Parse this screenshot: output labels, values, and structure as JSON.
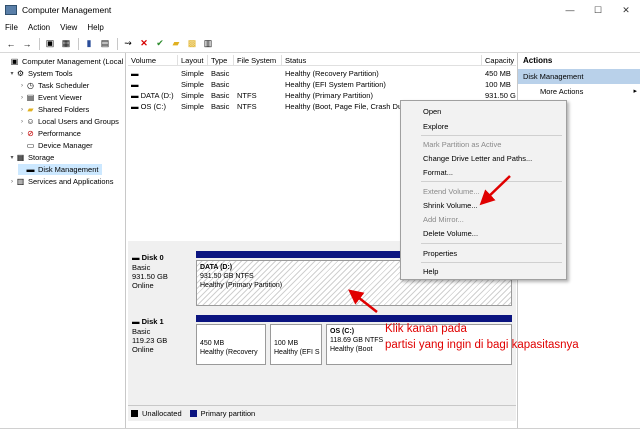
{
  "window": {
    "title": "Computer Management",
    "minimize": "—",
    "maximize": "☐",
    "close": "✕"
  },
  "menu": [
    "File",
    "Action",
    "View",
    "Help"
  ],
  "toolbar": [
    {
      "icon": "back-arrow-icon",
      "glyph": "←"
    },
    {
      "icon": "forward-arrow-icon",
      "glyph": "→"
    },
    {
      "icon": "up-folder-icon",
      "glyph": "▣"
    },
    {
      "icon": "show-hide-tree-icon",
      "glyph": "▦"
    },
    {
      "icon": "help-icon",
      "glyph": "▮"
    },
    {
      "icon": "properties-icon",
      "glyph": "▤"
    },
    {
      "icon": "connect-icon",
      "glyph": "⇝"
    },
    {
      "icon": "delete-icon",
      "glyph": "✕",
      "color": "#d60000"
    },
    {
      "icon": "checkmark-icon",
      "glyph": "✔",
      "color": "#2a8a2a"
    },
    {
      "icon": "folder-icon",
      "glyph": "▰",
      "color": "#e0b020"
    },
    {
      "icon": "search-folder-icon",
      "glyph": "▩",
      "color": "#e0b020"
    },
    {
      "icon": "export-icon",
      "glyph": "▥"
    }
  ],
  "tree": [
    {
      "label": "Computer Management (Local",
      "expander": "",
      "icon": "▣"
    },
    {
      "label": "System Tools",
      "expander": "▾",
      "icon": "⚙"
    },
    {
      "label": "Task Scheduler",
      "expander": "›",
      "icon": "◷"
    },
    {
      "label": "Event Viewer",
      "expander": "›",
      "icon": "▤"
    },
    {
      "label": "Shared Folders",
      "expander": "›",
      "icon": "▰"
    },
    {
      "label": "Local Users and Groups",
      "expander": "›",
      "icon": "☺"
    },
    {
      "label": "Performance",
      "expander": "›",
      "icon": "⊘"
    },
    {
      "label": "Device Manager",
      "expander": "",
      "icon": "▭"
    },
    {
      "label": "Storage",
      "expander": "▾",
      "icon": "▦"
    },
    {
      "label": "Disk Management",
      "expander": "",
      "icon": "▬"
    },
    {
      "label": "Services and Applications",
      "expander": "›",
      "icon": "▥"
    }
  ],
  "volume_table": {
    "headers": [
      "Volume",
      "Layout",
      "Type",
      "File System",
      "Status",
      "Capacity"
    ],
    "rows": [
      [
        "▬",
        "Simple",
        "Basic",
        "",
        "Healthy (Recovery Partition)",
        "450 MB"
      ],
      [
        "▬",
        "Simple",
        "Basic",
        "",
        "Healthy (EFI System Partition)",
        "100 MB"
      ],
      [
        "▬ DATA (D:)",
        "Simple",
        "Basic",
        "NTFS",
        "Healthy (Primary Partition)",
        "931.50 G"
      ],
      [
        "▬ OS (C:)",
        "Simple",
        "Basic",
        "NTFS",
        "Healthy (Boot, Page File, Crash Dum",
        ""
      ]
    ]
  },
  "disks": [
    {
      "name": "▬ Disk 0",
      "info": [
        "Basic",
        "931.50 GB",
        "Online"
      ],
      "partitions": [
        {
          "title": "DATA  (D:)",
          "size": "931.50 GB NTFS",
          "status": "Healthy (Primary Partition)"
        }
      ]
    },
    {
      "name": "▬ Disk 1",
      "info": [
        "Basic",
        "119.23 GB",
        "Online"
      ],
      "partitions": [
        {
          "title": "",
          "size": "450 MB",
          "status": "Healthy (Recovery"
        },
        {
          "title": "",
          "size": "100 MB",
          "status": "Healthy (EFI S"
        },
        {
          "title": "OS  (C:)",
          "size": "118.69 GB NTFS",
          "status": "Healthy (Boot"
        }
      ]
    }
  ],
  "legend": [
    {
      "label": "Unallocated",
      "color": "#000000"
    },
    {
      "label": "Primary partition",
      "color": "#0b1480"
    }
  ],
  "actions": {
    "title": "Actions",
    "section": "Disk Management",
    "more": "More Actions",
    "more_arrow": "▸"
  },
  "context_menu": [
    {
      "label": "Open",
      "disabled": false
    },
    {
      "label": "Explore",
      "disabled": false
    },
    {
      "label": "Mark Partition as Active",
      "disabled": true
    },
    {
      "label": "Change Drive Letter and Paths...",
      "disabled": false
    },
    {
      "label": "Format...",
      "disabled": false
    },
    {
      "label": "Extend Volume...",
      "disabled": true
    },
    {
      "label": "Shrink Volume...",
      "disabled": false
    },
    {
      "label": "Add Mirror...",
      "disabled": true
    },
    {
      "label": "Delete Volume...",
      "disabled": false
    },
    {
      "label": "Properties",
      "disabled": false
    },
    {
      "label": "Help",
      "disabled": false
    }
  ],
  "annotation": {
    "line1": "Klik kanan pada",
    "line2": "partisi yang ingin di bagi kapasitasnya",
    "color": "#e00000"
  },
  "colors": {
    "primary_partition": "#0b1480",
    "selected": "#cce8ff",
    "actions_header": "#b9d1ea"
  }
}
